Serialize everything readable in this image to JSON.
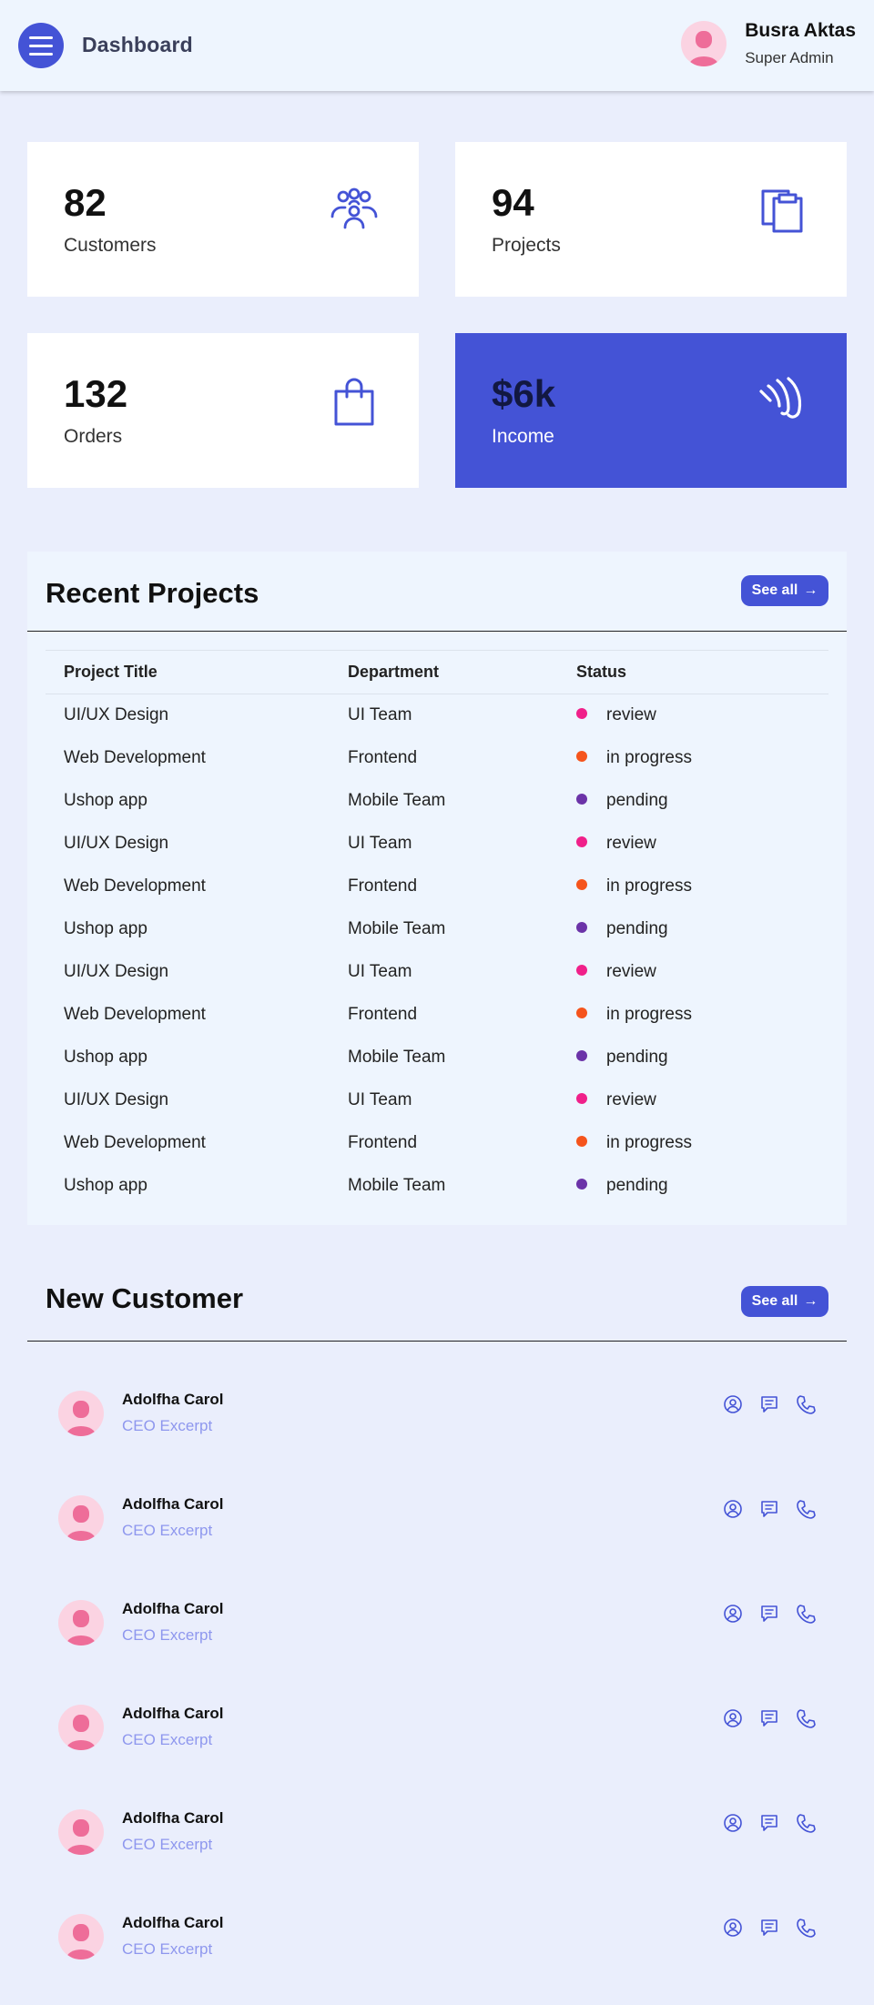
{
  "header": {
    "title": "Dashboard",
    "user_name": "Busra Aktas",
    "user_role": "Super Admin"
  },
  "stats": [
    {
      "value": "82",
      "label": "Customers",
      "icon": "users-icon"
    },
    {
      "value": "94",
      "label": "Projects",
      "icon": "clipboard-icon"
    },
    {
      "value": "132",
      "label": "Orders",
      "icon": "shopping-bag-icon"
    },
    {
      "value": "$6k",
      "label": "Income",
      "icon": "hand-wave-icon"
    }
  ],
  "recent_projects": {
    "title": "Recent Projects",
    "see_all": "See all",
    "columns": [
      "Project Title",
      "Department",
      "Status"
    ],
    "rows": [
      {
        "title": "UI/UX Design",
        "dept": "UI Team",
        "status": "review"
      },
      {
        "title": "Web Development",
        "dept": "Frontend",
        "status": "in progress"
      },
      {
        "title": "Ushop app",
        "dept": "Mobile Team",
        "status": "pending"
      },
      {
        "title": "UI/UX Design",
        "dept": "UI Team",
        "status": "review"
      },
      {
        "title": "Web Development",
        "dept": "Frontend",
        "status": "in progress"
      },
      {
        "title": "Ushop app",
        "dept": "Mobile Team",
        "status": "pending"
      },
      {
        "title": "UI/UX Design",
        "dept": "UI Team",
        "status": "review"
      },
      {
        "title": "Web Development",
        "dept": "Frontend",
        "status": "in progress"
      },
      {
        "title": "Ushop app",
        "dept": "Mobile Team",
        "status": "pending"
      },
      {
        "title": "UI/UX Design",
        "dept": "UI Team",
        "status": "review"
      },
      {
        "title": "Web Development",
        "dept": "Frontend",
        "status": "in progress"
      },
      {
        "title": "Ushop app",
        "dept": "Mobile Team",
        "status": "pending"
      }
    ],
    "status_colors": {
      "review": "#f0208a",
      "in progress": "#f5541c",
      "pending": "#6b33a8"
    }
  },
  "new_customer": {
    "title": "New Customer",
    "see_all": "See all",
    "items": [
      {
        "name": "Adolfha Carol",
        "role": "CEO Excerpt"
      },
      {
        "name": "Adolfha Carol",
        "role": "CEO Excerpt"
      },
      {
        "name": "Adolfha Carol",
        "role": "CEO Excerpt"
      },
      {
        "name": "Adolfha Carol",
        "role": "CEO Excerpt"
      },
      {
        "name": "Adolfha Carol",
        "role": "CEO Excerpt"
      },
      {
        "name": "Adolfha Carol",
        "role": "CEO Excerpt"
      }
    ],
    "actions": [
      "user-circle-icon",
      "message-icon",
      "phone-icon"
    ]
  },
  "colors": {
    "accent": "#4453d6",
    "background": "#eaeefc",
    "panel": "#eef5fe",
    "muted_text": "#8e97ee"
  }
}
